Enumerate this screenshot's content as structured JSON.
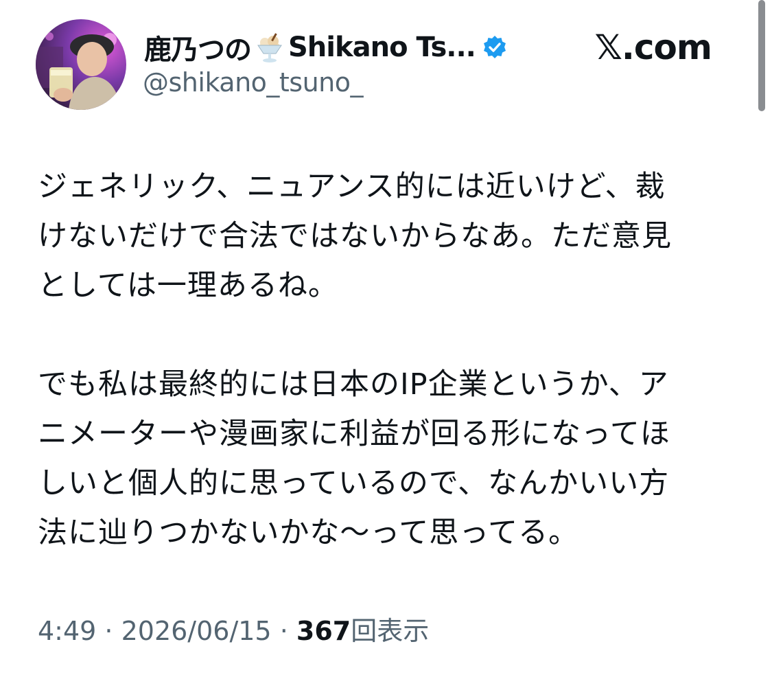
{
  "author": {
    "display_name_jp": "鹿乃つの",
    "display_name_en": "Shikano Ts...",
    "handle": "@shikano_tsuno_",
    "avatar_icon": "profile-photo",
    "name_emoji_icon": "ice-cream-sundae-icon",
    "verified_icon": "verified-badge-icon",
    "verified_color": "#1d9bf0"
  },
  "site": {
    "label": "𝕏.com"
  },
  "tweet": {
    "paragraphs": [
      "ジェネリック、ニュアンス的には近いけど、裁\nけないだけで合法ではないからなあ。ただ意見\nとしては一理あるね。",
      "でも私は最終的には日本のIP企業というか、ア\nニメーターや漫画家に利益が回る形になってほ\nしいと個人的に思っているので、なんかいい方\n法に辿りつかないかな〜って思ってる。"
    ]
  },
  "meta": {
    "time": "4:49",
    "separator": " · ",
    "date": "2026/06/15",
    "views_count": "367",
    "views_label": "回表示"
  },
  "colors": {
    "text": "#0f1419",
    "secondary_text": "#536471",
    "background": "#ffffff",
    "scrollbar": "#8a8d91"
  }
}
